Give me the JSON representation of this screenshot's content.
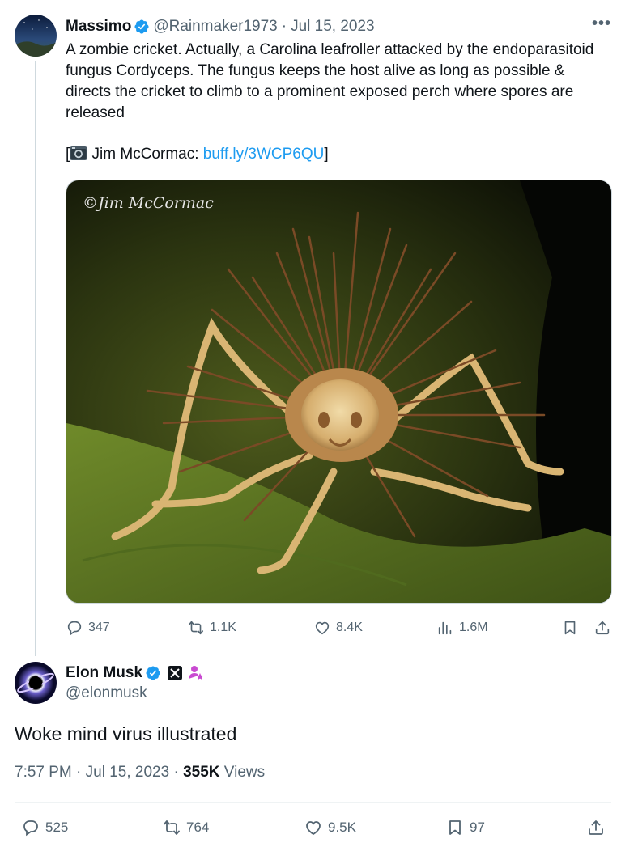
{
  "parent": {
    "name": "Massimo",
    "handle": "@Rainmaker1973",
    "sep": "·",
    "date": "Jul 15, 2023",
    "more": "•••",
    "text": "A zombie cricket. Actually, a Carolina leafroller attacked by the endoparasitoid fungus Cordyceps. The fungus keeps the host alive as long as possible & directs the cricket to climb to a prominent exposed perch where spores are released",
    "credit_prefix": "[",
    "credit_name": " Jim McCormac: ",
    "credit_link": "buff.ly/3WCP6QU",
    "credit_suffix": "]",
    "photo_watermark": "©Jim McCormac",
    "stats": {
      "replies": "347",
      "retweets": "1.1K",
      "likes": "8.4K",
      "views": "1.6M"
    }
  },
  "main": {
    "name": "Elon Musk",
    "handle": "@elonmusk",
    "text": "Woke mind virus illustrated",
    "time": "7:57 PM",
    "sep": "·",
    "date": "Jul 15, 2023",
    "sep2": "·",
    "views_count": "355K",
    "views_label": "Views",
    "stats": {
      "replies": "525",
      "retweets": "764",
      "likes": "9.5K",
      "bookmarks": "97"
    }
  },
  "colors": {
    "verified": "#1d9bf0",
    "link": "#1d9bf0",
    "muted": "#536471",
    "badge_pink": "#c94ad1"
  },
  "icons": [
    "verified-badge-icon",
    "camera-icon",
    "reply-icon",
    "retweet-icon",
    "like-icon",
    "views-icon",
    "bookmark-icon",
    "share-icon",
    "x-logo-badge-icon",
    "affiliate-badge-icon",
    "more-icon"
  ]
}
